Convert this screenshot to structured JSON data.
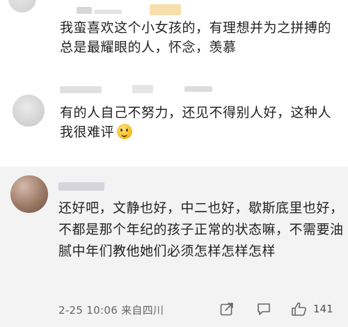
{
  "comments": [
    {
      "text": "我蛮喜欢这个小女孩的，有理想并为之拼搏的总是最耀眼的人，怀念，羡慕"
    },
    {
      "text": "有的人自己不努力，还见不得别人好，这种人我很难评",
      "emoji": "thinking-face-emoji"
    },
    {
      "text": "还好吧，文静也好，中二也好，歇斯底里也好，不都是那个年纪的孩子正常的状态嘛，不需要油腻中年们教他她们必须怎样怎样怎样",
      "meta": "2-25 10:06 来自四川",
      "likes": "141",
      "icons": [
        "share-icon",
        "comment-icon",
        "like-icon"
      ]
    }
  ],
  "colors": {
    "highlight_background": "#f3f3f3",
    "text": "#222222",
    "meta_text": "#666666"
  }
}
